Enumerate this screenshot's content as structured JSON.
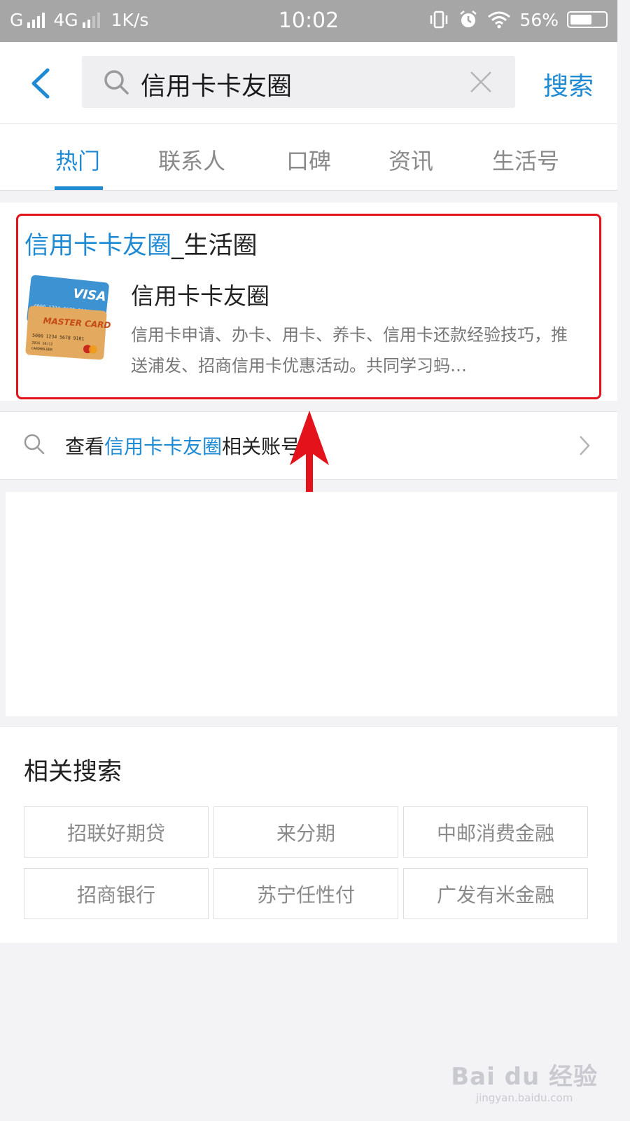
{
  "status": {
    "carrier": "G",
    "network": "4G",
    "speed": "1K/s",
    "time": "10:02",
    "battery": "56%"
  },
  "search": {
    "query": "信用卡卡友圈",
    "button": "搜索"
  },
  "tabs": [
    {
      "label": "热门",
      "active": true
    },
    {
      "label": "联系人",
      "active": false
    },
    {
      "label": "口碑",
      "active": false
    },
    {
      "label": "资讯",
      "active": false
    },
    {
      "label": "生活号",
      "active": false
    }
  ],
  "result": {
    "title_highlight": "信用卡卡友圈",
    "title_suffix": "_生活圈",
    "name": "信用卡卡友圈",
    "description": "信用卡申请、办卡、用卡、养卡、信用卡还款经验技巧，推送浦发、招商信用卡优惠活动。共同学习蚂…"
  },
  "related_accounts": {
    "prefix": "查看",
    "highlight": "信用卡卡友圈",
    "suffix": "相关账号"
  },
  "related_searches": {
    "title": "相关搜索",
    "items": [
      "招联好期贷",
      "来分期",
      "中邮消费金融",
      "招商银行",
      "苏宁任性付",
      "广发有米金融"
    ]
  },
  "watermark": {
    "brand": "Bai du 经验",
    "url": "jingyan.baidu.com"
  },
  "colors": {
    "accent": "#1e8ad4",
    "highlight_box": "#e3121b"
  }
}
